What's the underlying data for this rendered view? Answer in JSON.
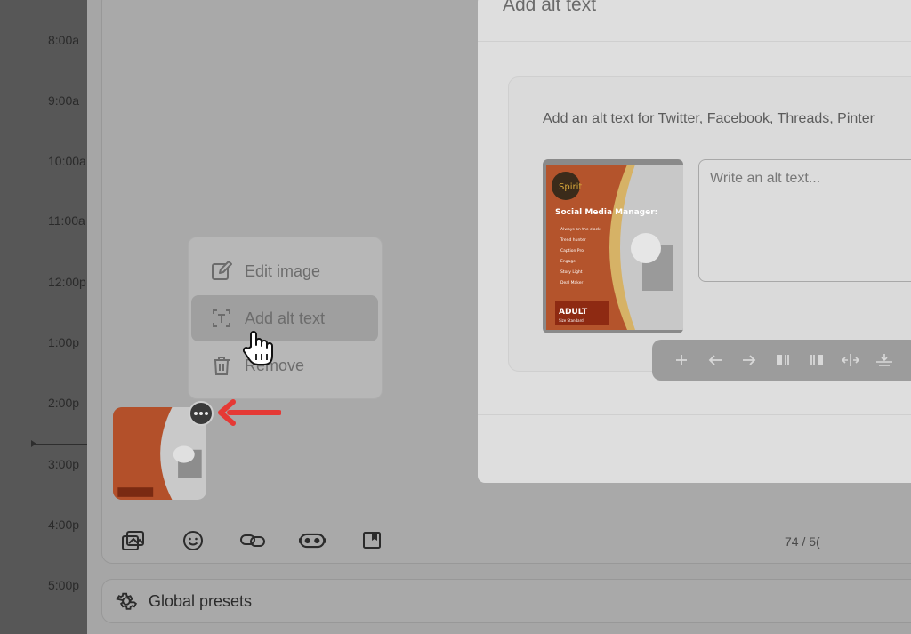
{
  "timeline": {
    "times": [
      "8:00a",
      "9:00a",
      "10:00a",
      "11:00a",
      "12:00p",
      "1:00p",
      "2:00p",
      "3:00p",
      "4:00p",
      "5:00p"
    ]
  },
  "composer": {
    "toolbar_icons": [
      "media-icon",
      "emoji-icon",
      "link-icon",
      "ai-assistant-icon",
      "bookmark-icon"
    ],
    "char_counter": "74 / 5("
  },
  "presets": {
    "label": "Global presets"
  },
  "context_menu": {
    "items": [
      {
        "label": "Edit image",
        "icon": "edit-icon"
      },
      {
        "label": "Add alt text",
        "icon": "text-box-icon"
      },
      {
        "label": "Remove",
        "icon": "trash-icon"
      }
    ]
  },
  "modal": {
    "title": "Add alt text",
    "description": "Add an alt text for Twitter, Facebook, Threads, Pinter",
    "input_placeholder": "Write an alt text..."
  },
  "image": {
    "title": "Social Media Manager:",
    "lines": [
      "Always on the clock",
      "Trend hunter",
      "Caption Pro",
      "Engage",
      "Story Light",
      "Deal Maker"
    ],
    "badge": "ADULT",
    "badge_sub": "Size Standard",
    "logo": "Spirit"
  },
  "image_toolbar": {
    "icons": [
      "plus-icon",
      "arrow-left-icon",
      "arrow-right-icon",
      "align-left-icon",
      "align-right-icon",
      "expand-horizontal-icon",
      "insert-icon"
    ]
  },
  "colors": {
    "accent_red": "#e53935",
    "overlay": "#a6a6a6"
  }
}
